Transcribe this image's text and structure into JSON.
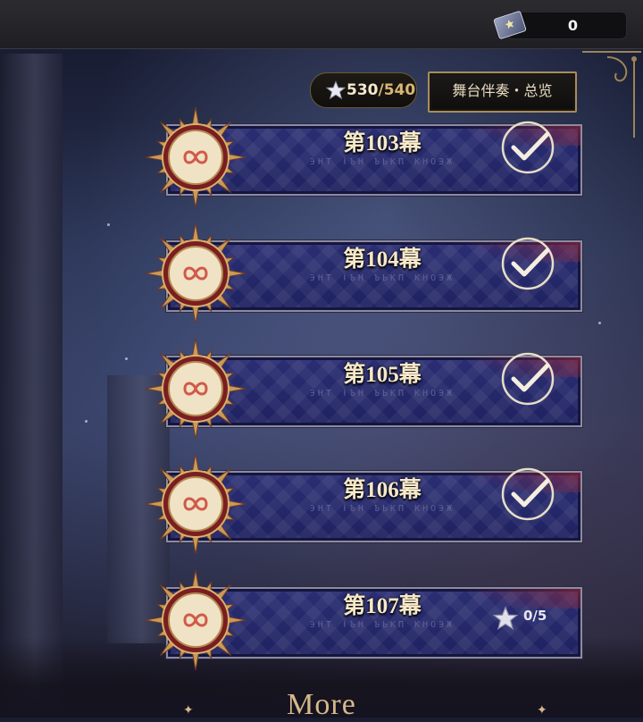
{
  "topbar": {
    "ticket_icon": "ticket-star-icon",
    "ticket_count": "0"
  },
  "stars": {
    "icon": "star-icon",
    "current": "530",
    "separator": "/",
    "max": "540"
  },
  "overview_button": {
    "label": "舞台伴奏・总览"
  },
  "stages": [
    {
      "title": "第103幕",
      "runes": "ЭНТ ⱡЪН ЪЬКП КНОЭЖ",
      "status": "completed"
    },
    {
      "title": "第104幕",
      "runes": "ЭНТ ⱡЪН ЪЬКП КНОЭЖ",
      "status": "completed"
    },
    {
      "title": "第105幕",
      "runes": "ЭНТ ⱡЪН ЪЬКП КНОЭЖ",
      "status": "completed"
    },
    {
      "title": "第106幕",
      "runes": "ЭНТ ⱡЪН ЪЬКП КНОЭЖ",
      "status": "completed"
    },
    {
      "title": "第107幕",
      "runes": "ЭНТ ⱡЪН ЪЬКП КНОЭЖ",
      "status": "in-progress",
      "progress": "0/5"
    }
  ],
  "more": {
    "label": "More"
  },
  "colors": {
    "panel": "#2b2e73",
    "gold": "#d8b774",
    "title": "#f6e8c9"
  }
}
